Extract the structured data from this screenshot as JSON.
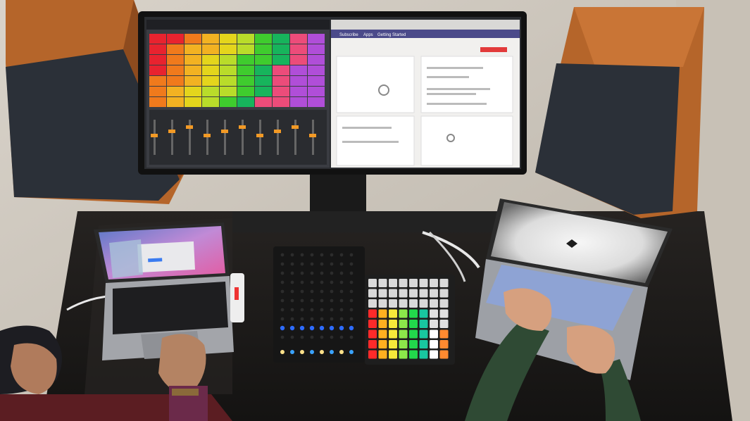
{
  "scene": {
    "description_tags": [
      "music-studio-desk",
      "overhead-view",
      "collaboration"
    ],
    "monitor": {
      "left_app": "daw-session-view",
      "right_app": "web-browser",
      "browser_tab_labels": [
        "Subscribe",
        "Apps",
        "Getting Started"
      ],
      "browser_red_button": "",
      "clip_colors": [
        "#e8232f",
        "#f07a1c",
        "#f2b222",
        "#e4d51c",
        "#b9dc2a",
        "#3fcc2e",
        "#17b45c",
        "#ec4c7a",
        "#b04ed8"
      ]
    },
    "left_laptop": {
      "screen": "macos-desktop-with-dialog"
    },
    "right_laptop": {
      "screen": "abstract-white-wallpaper"
    },
    "launchpad": {
      "pad_colors": [
        "#ff2a2a",
        "#ffb020",
        "#f6e83a",
        "#8ce84a",
        "#22d84c",
        "#18c7a0",
        "#ffffff",
        "#ff8a30"
      ]
    },
    "grid_controller": {
      "led_color": "#2e6cff"
    },
    "colors": {
      "wall": "#cfc9c0",
      "desk": "#1d1b1a",
      "speaker_wood": "#b5652a",
      "speaker_grille": "#2b3038",
      "sleeve_green": "#2f4a34"
    }
  }
}
